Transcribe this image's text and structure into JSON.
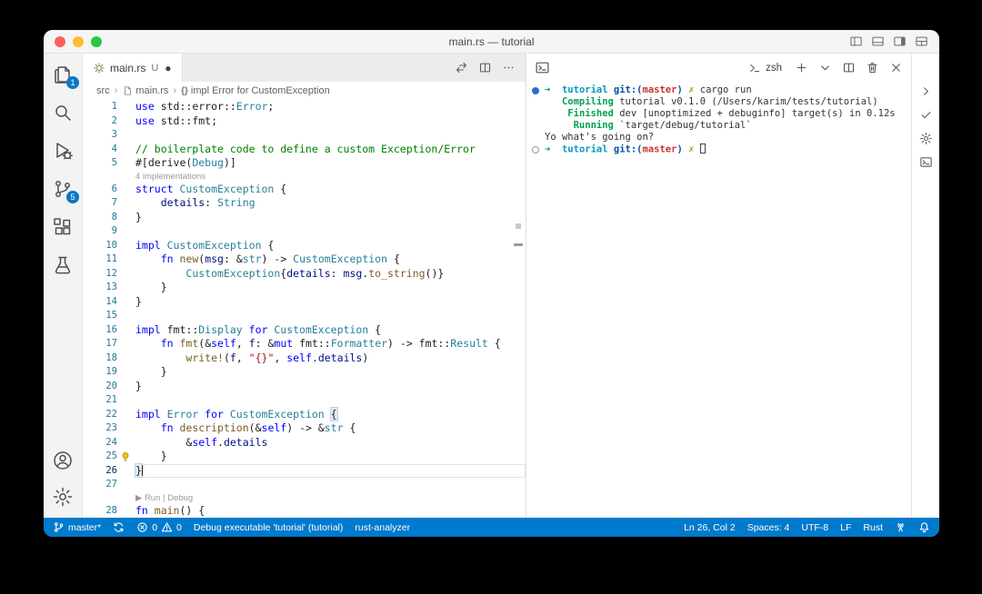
{
  "colors": {
    "status_bar": "#007acc",
    "badge": "#0a78c4",
    "accent": "#007acc"
  },
  "titlebar": {
    "title": "main.rs — tutorial",
    "traffic_lights": [
      "#ff5f57",
      "#febc2e",
      "#28c840"
    ],
    "actions": [
      "layout-sidebar-left-icon",
      "layout-panel-icon",
      "layout-sidebar-right-icon",
      "layout-customize-icon"
    ]
  },
  "activity_bar": {
    "items": [
      {
        "name": "explorer",
        "icon": "files-icon",
        "badge": "1"
      },
      {
        "name": "search",
        "icon": "search-icon"
      },
      {
        "name": "run-and-debug",
        "icon": "run-debug-icon"
      },
      {
        "name": "source-control",
        "icon": "source-control-icon",
        "badge": "5"
      },
      {
        "name": "extensions",
        "icon": "extensions-icon"
      },
      {
        "name": "testing",
        "icon": "beaker-icon"
      }
    ],
    "bottom": [
      {
        "name": "accounts",
        "icon": "account-icon"
      },
      {
        "name": "settings",
        "icon": "gear-icon"
      }
    ]
  },
  "editor": {
    "tab": {
      "icon": "rust-file-icon",
      "label": "main.rs",
      "git_status": "U",
      "dirty_indicator": "●"
    },
    "actions": [
      "open-changes-icon",
      "split-editor-icon",
      "more-actions-icon"
    ],
    "breadcrumb_separator": "›",
    "breadcrumb": [
      {
        "label": "src"
      },
      {
        "icon": "file-icon",
        "label": "main.rs"
      },
      {
        "glyph": "{}",
        "label": "impl Error for CustomException"
      }
    ],
    "cursor": {
      "line": 26,
      "col": 2
    },
    "lightbulb_line": 25,
    "lines": [
      {
        "n": 1,
        "t": [
          [
            "k",
            "use "
          ],
          [
            "p",
            "std::error::"
          ],
          [
            "t",
            "Error"
          ],
          [
            "p",
            ";"
          ]
        ]
      },
      {
        "n": 2,
        "t": [
          [
            "k",
            "use "
          ],
          [
            "p",
            "std::fmt;"
          ]
        ]
      },
      {
        "n": 3,
        "t": []
      },
      {
        "n": 4,
        "t": [
          [
            "c",
            "// boilerplate code to define a custom Exception/Error"
          ]
        ]
      },
      {
        "n": 5,
        "t": [
          [
            "p",
            "#[derive("
          ],
          [
            "t",
            "Debug"
          ],
          [
            "p",
            ")]"
          ]
        ]
      },
      {
        "lens": "4 implementations"
      },
      {
        "n": 6,
        "t": [
          [
            "k",
            "struct "
          ],
          [
            "t",
            "CustomException"
          ],
          [
            "p",
            " {"
          ]
        ]
      },
      {
        "n": 7,
        "t": [
          [
            "p",
            "    "
          ],
          [
            "v",
            "details"
          ],
          [
            "p",
            ": "
          ],
          [
            "t",
            "String"
          ]
        ]
      },
      {
        "n": 8,
        "t": [
          [
            "p",
            "}"
          ]
        ]
      },
      {
        "n": 9,
        "t": []
      },
      {
        "n": 10,
        "t": [
          [
            "k",
            "impl "
          ],
          [
            "t",
            "CustomException"
          ],
          [
            "p",
            " {"
          ]
        ]
      },
      {
        "n": 11,
        "t": [
          [
            "p",
            "    "
          ],
          [
            "k",
            "fn "
          ],
          [
            "f",
            "new"
          ],
          [
            "p",
            "("
          ],
          [
            "v",
            "msg"
          ],
          [
            "p",
            ": &"
          ],
          [
            "t",
            "str"
          ],
          [
            "p",
            ") -> "
          ],
          [
            "t",
            "CustomException"
          ],
          [
            "p",
            " {"
          ]
        ]
      },
      {
        "n": 12,
        "t": [
          [
            "p",
            "        "
          ],
          [
            "t",
            "CustomException"
          ],
          [
            "p",
            "{"
          ],
          [
            "v",
            "details"
          ],
          [
            "p",
            ": "
          ],
          [
            "v",
            "msg"
          ],
          [
            "p",
            "."
          ],
          [
            "f",
            "to_string"
          ],
          [
            "p",
            "()}"
          ]
        ]
      },
      {
        "n": 13,
        "t": [
          [
            "p",
            "    }"
          ]
        ]
      },
      {
        "n": 14,
        "t": [
          [
            "p",
            "}"
          ]
        ]
      },
      {
        "n": 15,
        "t": []
      },
      {
        "n": 16,
        "t": [
          [
            "k",
            "impl "
          ],
          [
            "p",
            "fmt::"
          ],
          [
            "t",
            "Display"
          ],
          [
            "k",
            " for "
          ],
          [
            "t",
            "CustomException"
          ],
          [
            "p",
            " {"
          ]
        ]
      },
      {
        "n": 17,
        "t": [
          [
            "p",
            "    "
          ],
          [
            "k",
            "fn "
          ],
          [
            "f",
            "fmt"
          ],
          [
            "p",
            "(&"
          ],
          [
            "k",
            "self"
          ],
          [
            "p",
            ", "
          ],
          [
            "v",
            "f"
          ],
          [
            "p",
            ": &"
          ],
          [
            "k",
            "mut "
          ],
          [
            "p",
            "fmt::"
          ],
          [
            "t",
            "Formatter"
          ],
          [
            "p",
            ") -> fmt::"
          ],
          [
            "t",
            "Result"
          ],
          [
            "p",
            " {"
          ]
        ]
      },
      {
        "n": 18,
        "t": [
          [
            "p",
            "        "
          ],
          [
            "f",
            "write!"
          ],
          [
            "p",
            "("
          ],
          [
            "v",
            "f"
          ],
          [
            "p",
            ", "
          ],
          [
            "s",
            "\"{}\""
          ],
          [
            "p",
            ", "
          ],
          [
            "k",
            "self"
          ],
          [
            "p",
            "."
          ],
          [
            "v",
            "details"
          ],
          [
            "p",
            ")"
          ]
        ]
      },
      {
        "n": 19,
        "t": [
          [
            "p",
            "    }"
          ]
        ]
      },
      {
        "n": 20,
        "t": [
          [
            "p",
            "}"
          ]
        ]
      },
      {
        "n": 21,
        "t": []
      },
      {
        "n": 22,
        "t": [
          [
            "k",
            "impl "
          ],
          [
            "t",
            "Error"
          ],
          [
            "k",
            " for "
          ],
          [
            "t",
            "CustomException"
          ],
          [
            "p",
            " "
          ],
          [
            "bm",
            "{"
          ]
        ]
      },
      {
        "n": 23,
        "t": [
          [
            "p",
            "    "
          ],
          [
            "k",
            "fn "
          ],
          [
            "f",
            "description"
          ],
          [
            "p",
            "(&"
          ],
          [
            "k",
            "self"
          ],
          [
            "p",
            ") -> &"
          ],
          [
            "t",
            "str"
          ],
          [
            "p",
            " {"
          ]
        ]
      },
      {
        "n": 24,
        "t": [
          [
            "p",
            "        &"
          ],
          [
            "k",
            "self"
          ],
          [
            "p",
            "."
          ],
          [
            "v",
            "details"
          ]
        ]
      },
      {
        "n": 25,
        "t": [
          [
            "p",
            "    }"
          ]
        ]
      },
      {
        "n": 26,
        "t": [
          [
            "bm",
            "}"
          ]
        ]
      },
      {
        "n": 27,
        "t": []
      },
      {
        "lens": "▶ Run | Debug"
      },
      {
        "n": 28,
        "t": [
          [
            "k",
            "fn "
          ],
          [
            "f",
            "main"
          ],
          [
            "p",
            "() {"
          ]
        ]
      }
    ]
  },
  "terminal": {
    "tab_label": "zsh",
    "actions": [
      "new-terminal-icon",
      "chevron-down-icon",
      "split-terminal-icon",
      "kill-terminal-icon",
      "close-panel-icon"
    ],
    "strip_icons": [
      "chevron-right-icon",
      "check-icon",
      "gear-icon",
      "terminal-box-icon"
    ],
    "lines": [
      {
        "dec": "filled",
        "t": [
          [
            "g",
            "➜"
          ],
          [
            "p",
            "  "
          ],
          [
            "cy",
            "tutorial"
          ],
          [
            "p",
            " "
          ],
          [
            "bl",
            "git:("
          ],
          [
            "rd",
            "master"
          ],
          [
            "bl",
            ")"
          ],
          [
            "p",
            " "
          ],
          [
            "yl",
            "✗"
          ],
          [
            "p",
            " cargo run"
          ]
        ]
      },
      {
        "t": [
          [
            "p",
            "   "
          ],
          [
            "g",
            "Compiling"
          ],
          [
            "p",
            " tutorial v0.1.0 (/Users/karim/tests/tutorial)"
          ]
        ]
      },
      {
        "t": [
          [
            "p",
            "    "
          ],
          [
            "g",
            "Finished"
          ],
          [
            "p",
            " dev [unoptimized + debuginfo] target(s) in 0.12s"
          ]
        ]
      },
      {
        "t": [
          [
            "p",
            "     "
          ],
          [
            "g",
            "Running"
          ],
          [
            "p",
            " `target/debug/tutorial`"
          ]
        ]
      },
      {
        "t": [
          [
            "p",
            "Yo what's going on?"
          ]
        ]
      },
      {
        "dec": "outline",
        "cursor": true,
        "t": [
          [
            "g",
            "➜"
          ],
          [
            "p",
            "  "
          ],
          [
            "cy",
            "tutorial"
          ],
          [
            "p",
            " "
          ],
          [
            "bl",
            "git:("
          ],
          [
            "rd",
            "master"
          ],
          [
            "bl",
            ")"
          ],
          [
            "p",
            " "
          ],
          [
            "yl",
            "✗"
          ],
          [
            "p",
            " "
          ]
        ]
      }
    ]
  },
  "status_bar": {
    "left": [
      {
        "name": "git-branch",
        "parts": [
          {
            "icon": "git-branch-icon"
          },
          {
            "text": "master*"
          }
        ]
      },
      {
        "name": "sync",
        "parts": [
          {
            "icon": "sync-icon"
          }
        ]
      },
      {
        "name": "problems",
        "parts": [
          {
            "icon": "error-icon"
          },
          {
            "text": "0"
          },
          {
            "icon": "warning-icon"
          },
          {
            "text": "0"
          }
        ]
      },
      {
        "name": "debug-target",
        "parts": [
          {
            "text": "Debug executable 'tutorial' (tutorial)"
          }
        ]
      },
      {
        "name": "rust-analyzer",
        "parts": [
          {
            "text": "rust-analyzer"
          }
        ]
      }
    ],
    "right": [
      {
        "name": "cursor-position",
        "parts": [
          {
            "text": "Ln 26, Col 2"
          }
        ]
      },
      {
        "name": "indentation",
        "parts": [
          {
            "text": "Spaces: 4"
          }
        ]
      },
      {
        "name": "encoding",
        "parts": [
          {
            "text": "UTF-8"
          }
        ]
      },
      {
        "name": "eol",
        "parts": [
          {
            "text": "LF"
          }
        ]
      },
      {
        "name": "language-mode",
        "parts": [
          {
            "text": "Rust"
          }
        ]
      },
      {
        "name": "remote-indicator",
        "parts": [
          {
            "icon": "remote-indicator-icon"
          }
        ]
      },
      {
        "name": "notifications",
        "parts": [
          {
            "icon": "bell-icon"
          }
        ]
      }
    ]
  }
}
